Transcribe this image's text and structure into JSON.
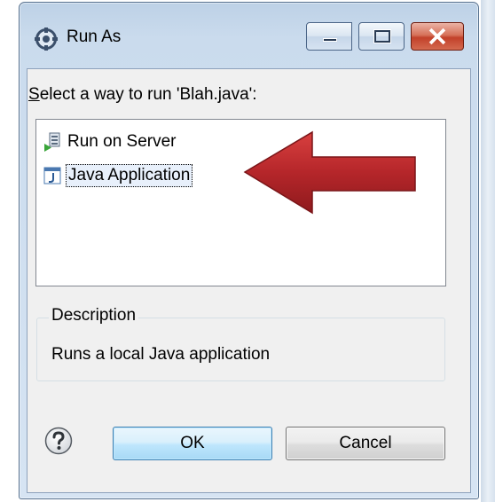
{
  "window": {
    "title": "Run As",
    "app_icon": "gear-icon",
    "controls": {
      "minimize": "minimize-icon",
      "maximize": "maximize-icon",
      "close": "close-icon"
    }
  },
  "prompt": {
    "mnemonic": "S",
    "rest": "elect a way to run 'Blah.java':"
  },
  "list": {
    "items": [
      {
        "label": "Run on Server",
        "icon": "server-icon",
        "selected": false
      },
      {
        "label": "Java Application",
        "icon": "java-app-icon",
        "selected": true
      }
    ]
  },
  "annotation": {
    "icon": "red-arrow-left-icon",
    "color": "#b5262a"
  },
  "description": {
    "group_label": "Description",
    "text": "Runs a local Java application"
  },
  "buttons": {
    "help_icon": "help-icon",
    "ok": "OK",
    "cancel": "Cancel"
  }
}
